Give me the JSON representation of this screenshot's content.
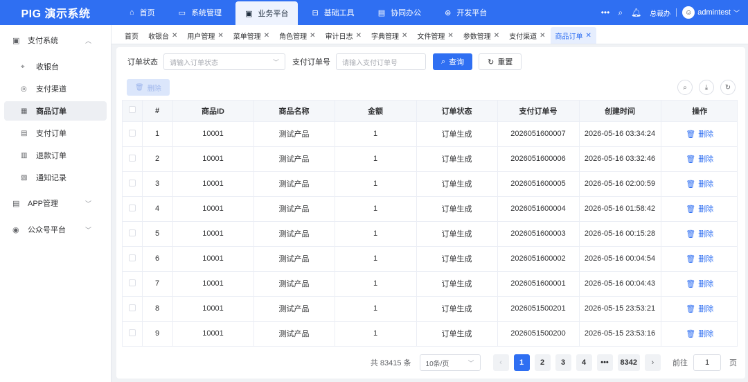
{
  "brand": "PIG 演示系统",
  "top_nav": [
    {
      "label": "首页",
      "icon": "home-icon"
    },
    {
      "label": "系统管理",
      "icon": "system-icon"
    },
    {
      "label": "业务平台",
      "icon": "monitor-icon",
      "active": true
    },
    {
      "label": "基础工具",
      "icon": "toolbox-icon"
    },
    {
      "label": "协同办公",
      "icon": "office-icon"
    },
    {
      "label": "开发平台",
      "icon": "dev-icon"
    }
  ],
  "top_right": {
    "more": "•••",
    "tenant": "总裁办",
    "user": "admintest"
  },
  "sidebar": {
    "groups": [
      {
        "label": "支付系统",
        "icon": "payment-system-icon",
        "expanded": true,
        "items": [
          {
            "label": "收银台",
            "icon": "cashier-icon"
          },
          {
            "label": "支付渠道",
            "icon": "channel-icon"
          },
          {
            "label": "商品订单",
            "icon": "product-order-icon",
            "active": true
          },
          {
            "label": "支付订单",
            "icon": "pay-order-icon"
          },
          {
            "label": "退款订单",
            "icon": "refund-order-icon"
          },
          {
            "label": "通知记录",
            "icon": "notify-record-icon"
          }
        ]
      },
      {
        "label": "APP管理",
        "icon": "app-icon"
      },
      {
        "label": "公众号平台",
        "icon": "wechat-icon"
      }
    ]
  },
  "tabs": [
    {
      "label": "首页",
      "closable": false
    },
    {
      "label": "收银台",
      "closable": true
    },
    {
      "label": "用户管理",
      "closable": true
    },
    {
      "label": "菜单管理",
      "closable": true
    },
    {
      "label": "角色管理",
      "closable": true
    },
    {
      "label": "审计日志",
      "closable": true
    },
    {
      "label": "字典管理",
      "closable": true
    },
    {
      "label": "文件管理",
      "closable": true
    },
    {
      "label": "参数管理",
      "closable": true
    },
    {
      "label": "支付渠道",
      "closable": true
    },
    {
      "label": "商品订单",
      "closable": true,
      "active": true
    }
  ],
  "filters": {
    "status_label": "订单状态",
    "status_placeholder": "请输入订单状态",
    "pay_no_label": "支付订单号",
    "pay_no_placeholder": "请输入支付订单号",
    "query": "查询",
    "reset": "重置"
  },
  "delete_button": "删除",
  "table": {
    "columns": [
      "",
      "#",
      "商品ID",
      "商品名称",
      "金额",
      "订单状态",
      "支付订单号",
      "创建时间",
      "操作"
    ],
    "action_label": "删除",
    "rows": [
      {
        "idx": "1",
        "goods_id": "10001",
        "name": "测试产品",
        "amount": "1",
        "status": "订单生成",
        "pay_no": "2026051600007",
        "created": "2026-05-16 03:34:24"
      },
      {
        "idx": "2",
        "goods_id": "10001",
        "name": "测试产品",
        "amount": "1",
        "status": "订单生成",
        "pay_no": "2026051600006",
        "created": "2026-05-16 03:32:46"
      },
      {
        "idx": "3",
        "goods_id": "10001",
        "name": "测试产品",
        "amount": "1",
        "status": "订单生成",
        "pay_no": "2026051600005",
        "created": "2026-05-16 02:00:59"
      },
      {
        "idx": "4",
        "goods_id": "10001",
        "name": "测试产品",
        "amount": "1",
        "status": "订单生成",
        "pay_no": "2026051600004",
        "created": "2026-05-16 01:58:42"
      },
      {
        "idx": "5",
        "goods_id": "10001",
        "name": "测试产品",
        "amount": "1",
        "status": "订单生成",
        "pay_no": "2026051600003",
        "created": "2026-05-16 00:15:28"
      },
      {
        "idx": "6",
        "goods_id": "10001",
        "name": "测试产品",
        "amount": "1",
        "status": "订单生成",
        "pay_no": "2026051600002",
        "created": "2026-05-16 00:04:54"
      },
      {
        "idx": "7",
        "goods_id": "10001",
        "name": "测试产品",
        "amount": "1",
        "status": "订单生成",
        "pay_no": "2026051600001",
        "created": "2026-05-16 00:04:43"
      },
      {
        "idx": "8",
        "goods_id": "10001",
        "name": "测试产品",
        "amount": "1",
        "status": "订单生成",
        "pay_no": "2026051500201",
        "created": "2026-05-15 23:53:21"
      },
      {
        "idx": "9",
        "goods_id": "10001",
        "name": "测试产品",
        "amount": "1",
        "status": "订单生成",
        "pay_no": "2026051500200",
        "created": "2026-05-15 23:53:16"
      }
    ]
  },
  "pagination": {
    "total": "共 83415 条",
    "page_size": "10条/页",
    "pages": [
      "1",
      "2",
      "3",
      "4",
      "•••",
      "8342"
    ],
    "current": "1",
    "goto_label": "前往",
    "goto_value": "1",
    "page_unit": "页"
  },
  "colors": {
    "primary": "#2f6ff2",
    "sidebar_active_bg": "#edeff3"
  }
}
